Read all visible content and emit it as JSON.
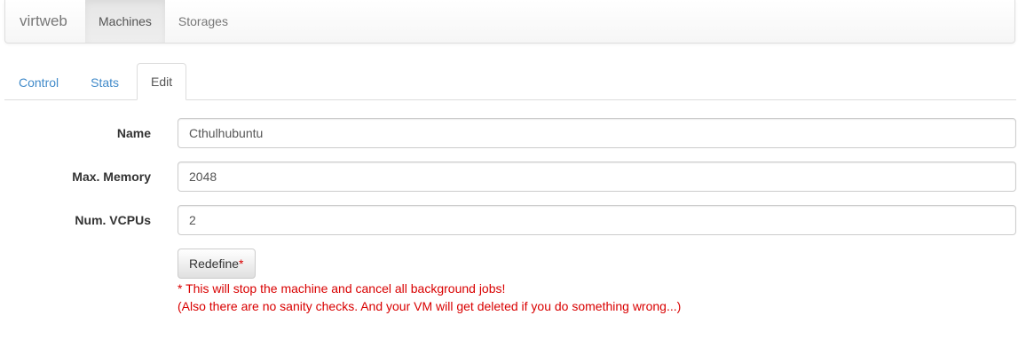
{
  "navbar": {
    "brand": "virtweb",
    "items": [
      {
        "label": "Machines",
        "active": true
      },
      {
        "label": "Storages",
        "active": false
      }
    ]
  },
  "tabs": [
    {
      "label": "Control",
      "active": false
    },
    {
      "label": "Stats",
      "active": false
    },
    {
      "label": "Edit",
      "active": true
    }
  ],
  "form": {
    "name": {
      "label": "Name",
      "value": "Cthulhubuntu"
    },
    "max_memory": {
      "label": "Max. Memory",
      "value": "2048"
    },
    "num_vcpus": {
      "label": "Num. VCPUs",
      "value": "2"
    },
    "redefine_button": {
      "label": "Redefine",
      "marker": "*"
    },
    "warning_line1": "* This will stop the machine and cancel all background jobs!",
    "warning_line2": "(Also there are no sanity checks. And your VM will get deleted if you do something wrong...)"
  },
  "colors": {
    "link": "#428bca",
    "warning": "#d90000"
  }
}
